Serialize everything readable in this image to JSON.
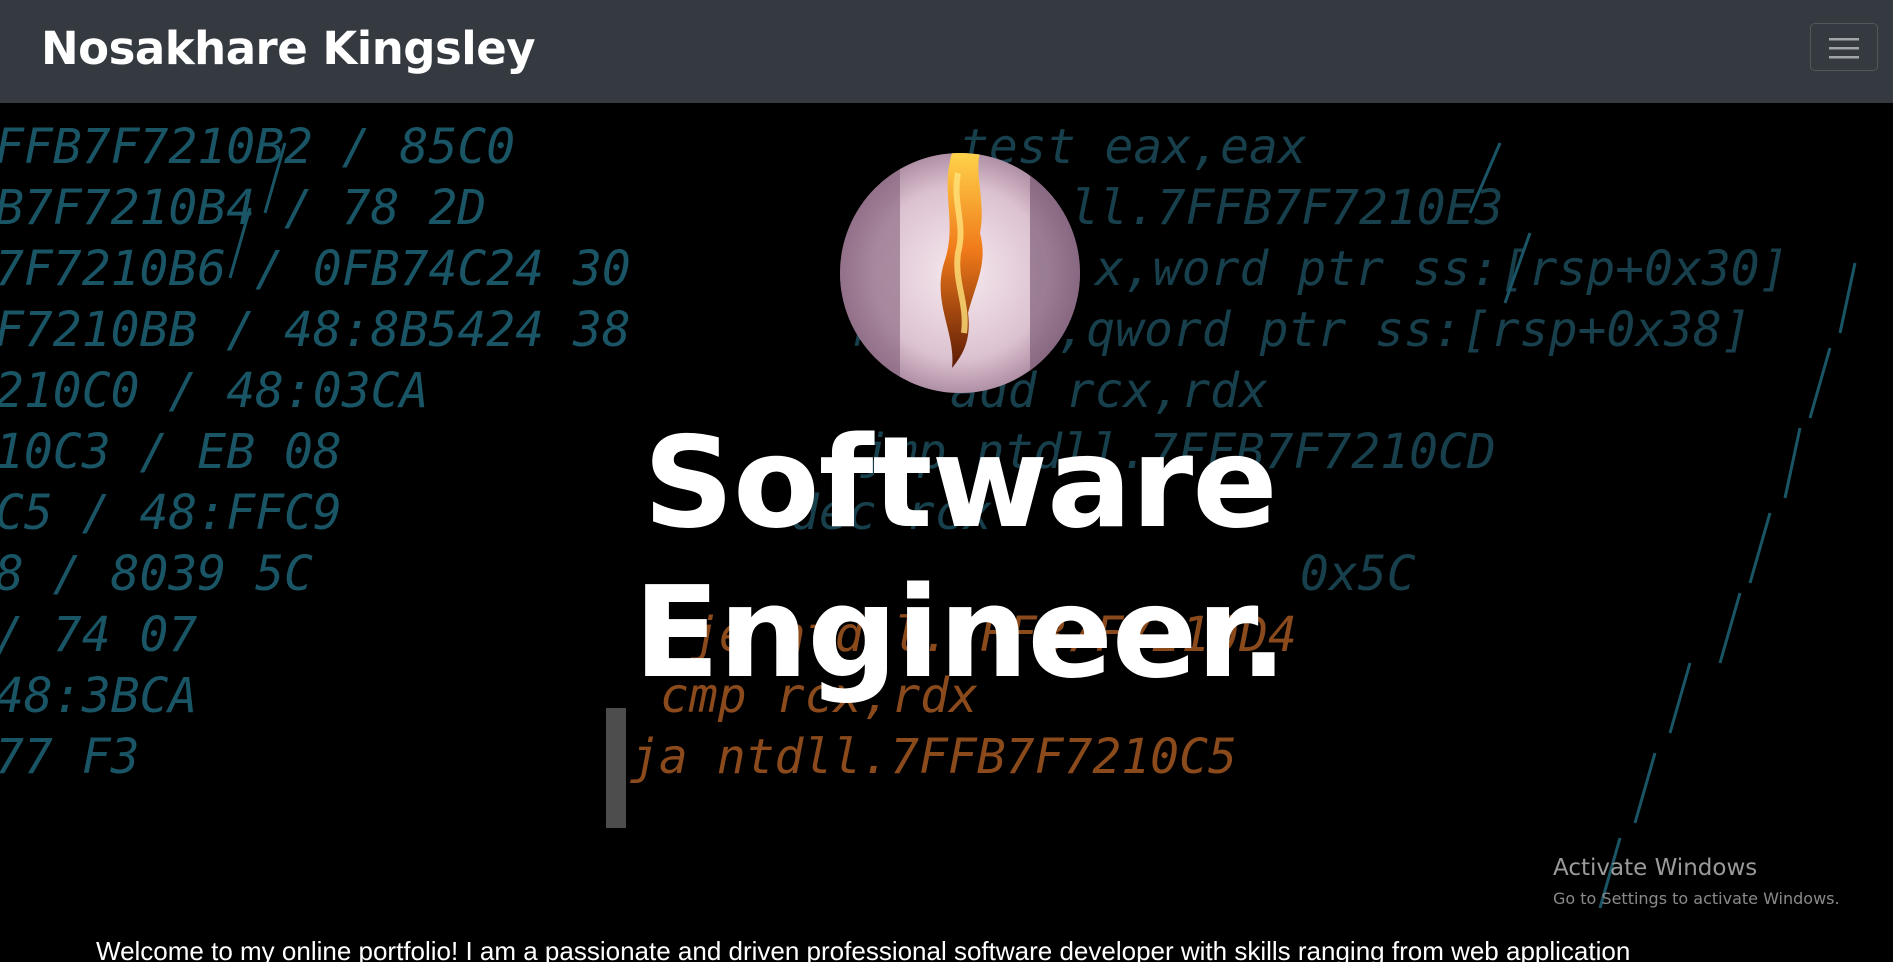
{
  "navbar": {
    "brand": "Nosakhare Kingsley",
    "toggler_icon": "hamburger-menu-icon"
  },
  "hero": {
    "avatar_alt": "profile-photo",
    "headline_line1": "Software",
    "headline_line2": "Engineer.",
    "intro_text": "Welcome to my online portfolio! I am a passionate and driven professional software developer with skills ranging from web application"
  },
  "code_background": {
    "left_column": [
      "FFB7F7210B2 / 85C0",
      "B7F7210B4 / 78 2D",
      "7F7210B6 / 0FB74C24 30",
      "F7210BB / 48:8B5424 38",
      "210C0 / 48:03CA",
      "10C3 / EB 08",
      "C5 / 48:FFC9",
      "8 / 8039 5C",
      "/ 74 07",
      "48:3BCA",
      "77 F3"
    ],
    "right_column": [
      "test eax,eax",
      "ll.7FFB7F7210E3",
      "x,word ptr ss:[rsp+0x30]",
      "mov rax,qword ptr ss:[rsp+0x38]",
      "add rcx,rdx",
      "jmp ntdll.7FFB7F7210CD",
      "dec rcx",
      "0x5C",
      "je ntdll.7FFB7F7210D4",
      "cmp rcx,rdx",
      "ja ntdll.7FFB7F7210C5"
    ]
  },
  "watermark": {
    "title": "Activate Windows",
    "subtitle": "Go to Settings to activate Windows."
  },
  "colors": {
    "navbar_bg": "#343a40",
    "code_teal": "#1d5b6b",
    "code_orange": "#a8541c"
  }
}
